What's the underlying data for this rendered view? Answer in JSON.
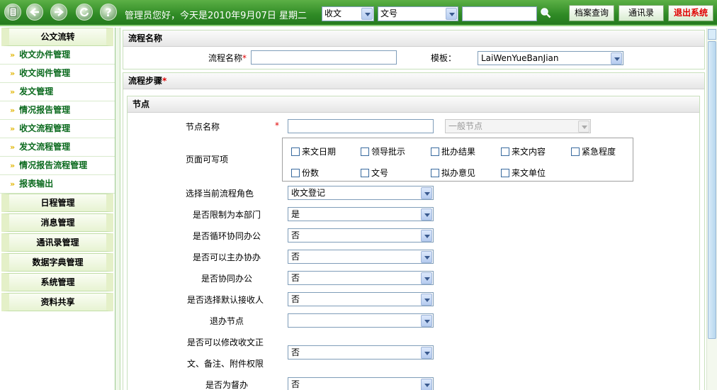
{
  "topbar": {
    "greeting": "管理员您好，今天是2010年9月07日 星期二",
    "select_type": "收文",
    "select_field": "文号",
    "search_value": "",
    "buttons": [
      "档案查询",
      "通讯录",
      "退出系统"
    ],
    "colors": {
      "bar": "#2f8a25",
      "exit_text": "#e00000"
    },
    "icons": [
      "document-icon",
      "back-arrow-icon",
      "forward-arrow-icon",
      "refresh-icon",
      "help-icon",
      "search-icon"
    ]
  },
  "sidebar": {
    "groups": [
      {
        "label": "公文流转",
        "items": [
          "收文办件管理",
          "收文阅件管理",
          "发文管理",
          "情况报告管理",
          "收文流程管理",
          "发文流程管理",
          "情况报告流程管理",
          "报表输出"
        ]
      },
      {
        "label": "日程管理",
        "items": []
      },
      {
        "label": "消息管理",
        "items": []
      },
      {
        "label": "通讯录管理",
        "items": []
      },
      {
        "label": "数据字典管理",
        "items": []
      },
      {
        "label": "系统管理",
        "items": []
      },
      {
        "label": "资料共享",
        "items": []
      }
    ],
    "item_marker": "»"
  },
  "main": {
    "flow_name_section": {
      "title": "流程名称",
      "name_label": "流程名称",
      "name_value": "",
      "template_label": "模板：",
      "template_value": "LaiWenYueBanJian"
    },
    "flow_steps_section": {
      "title": "流程步骤"
    },
    "node": {
      "title": "节点",
      "node_name_label": "节点名称",
      "node_name_value": "",
      "node_type_value": "一般节点",
      "writable_label": "页面可写项",
      "writable_options": [
        "来文日期",
        "领导批示",
        "批办结果",
        "来文内容",
        "紧急程度",
        "份数",
        "文号",
        "拟办意见",
        "来文单位"
      ],
      "fields": [
        {
          "label": "选择当前流程角色",
          "value": "收文登记"
        },
        {
          "label": "是否限制为本部门",
          "value": "是"
        },
        {
          "label": "是否循环协同办公",
          "value": "否"
        },
        {
          "label": "是否可以主办协办",
          "value": "否"
        },
        {
          "label": "是否协同办公",
          "value": "否"
        },
        {
          "label": "是否选择默认接收人",
          "value": "否"
        },
        {
          "label": "退办节点",
          "value": ""
        },
        {
          "label_line1": "是否可以修改收文正",
          "label_line2": "文、备注、附件权限",
          "value": "否"
        },
        {
          "label": "是否为督办",
          "value": "否"
        }
      ]
    }
  }
}
